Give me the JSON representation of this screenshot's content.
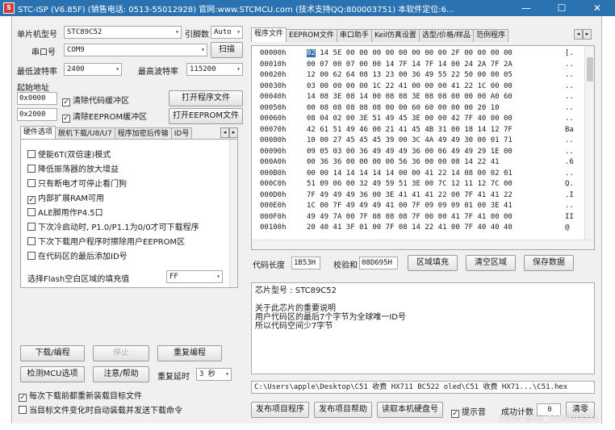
{
  "titlebar": {
    "title": "STC-ISP (V6.85F) (销售电话: 0513-55012928) 官网:www.STCMCU.com (技术支持QQ:800003751) 本软件定位:6...",
    "minimize": "—",
    "maximize": "☐",
    "close": "✕"
  },
  "left": {
    "mcu_label": "单片机型号",
    "mcu_value": "STC89C52",
    "pins_label": "引脚数",
    "pins_value": "Auto",
    "port_label": "串口号",
    "port_value": "COM9",
    "scan_button": "扫描",
    "min_baud_label": "最低波特率",
    "min_baud_value": "2400",
    "max_baud_label": "最高波特率",
    "max_baud_value": "115200",
    "start_addr_label": "起始地址",
    "addr1": "0x0000",
    "clear_code": "清除代码缓冲区",
    "open_program": "打开程序文件",
    "addr2": "0x2000",
    "clear_eeprom": "清除EEPROM缓冲区",
    "open_eeprom": "打开EEPROM文件"
  },
  "left_tabs": [
    "硬件选项",
    "脱机下载/U8/U7",
    "程序加密后传输",
    "ID号"
  ],
  "options": [
    {
      "label": "使能6T(双倍速)模式",
      "checked": false
    },
    {
      "label": "降低振荡器的放大增益",
      "checked": false
    },
    {
      "label": "只有断电才可停止看门狗",
      "checked": false
    },
    {
      "label": "内部扩展RAM可用",
      "checked": true
    },
    {
      "label": "ALE脚用作P4.5口",
      "checked": false
    },
    {
      "label": "下次冷启动时, P1.0/P1.1为0/0才可下载程序",
      "checked": false
    },
    {
      "label": "下次下载用户程序时擦除用户EEPROM区",
      "checked": false
    },
    {
      "label": "在代码区的最后添加ID号",
      "checked": false
    }
  ],
  "fill": {
    "label": "选择Flash空白区域的填充值",
    "value": "FF"
  },
  "actions": {
    "download": "下载/编程",
    "stop": "停止",
    "reprogram": "重复编程",
    "check_mcu": "检测MCU选项",
    "help": "注意/帮助",
    "delay_label": "重复延时",
    "delay_value": "3 秒",
    "reload_each": "每次下载前都重新装载目标文件",
    "auto_reload": "当目标文件变化时自动装载并发送下载命令"
  },
  "right_tabs": [
    "程序文件",
    "EEPROM文件",
    "串口助手",
    "Keil仿真设置",
    "选型/价格/样品",
    "范例程序"
  ],
  "hex": {
    "rows": [
      {
        "addr": "00000h",
        "bytes": [
          "02",
          "14",
          "5E",
          "00",
          "00",
          "00",
          "00",
          "00",
          "00",
          "00",
          "00",
          "2F",
          "00",
          "00",
          "00",
          "00"
        ],
        "ascii": "[."
      },
      {
        "addr": "00010h",
        "bytes": [
          "00",
          "07",
          "00",
          "07",
          "00",
          "00",
          "14",
          "7F",
          "14",
          "7F",
          "14",
          "00",
          "24",
          "2A",
          "7F",
          "2A"
        ],
        "ascii": ".."
      },
      {
        "addr": "00020h",
        "bytes": [
          "12",
          "00",
          "62",
          "64",
          "08",
          "13",
          "23",
          "00",
          "36",
          "49",
          "55",
          "22",
          "50",
          "00",
          "00",
          "05"
        ],
        "ascii": ".."
      },
      {
        "addr": "00030h",
        "bytes": [
          "03",
          "00",
          "00",
          "00",
          "00",
          "1C",
          "22",
          "41",
          "00",
          "00",
          "00",
          "41",
          "22",
          "1C",
          "00",
          "00"
        ],
        "ascii": ".."
      },
      {
        "addr": "00040h",
        "bytes": [
          "14",
          "08",
          "3E",
          "08",
          "14",
          "00",
          "08",
          "08",
          "3E",
          "08",
          "08",
          "00",
          "00",
          "00",
          "A0",
          "60"
        ],
        "ascii": ".."
      },
      {
        "addr": "00050h",
        "bytes": [
          "00",
          "08",
          "08",
          "08",
          "08",
          "08",
          "00",
          "00",
          "60",
          "60",
          "00",
          "00",
          "00",
          "20",
          "10"
        ],
        "ascii": ".."
      },
      {
        "addr": "00060h",
        "bytes": [
          "08",
          "04",
          "02",
          "00",
          "3E",
          "51",
          "49",
          "45",
          "3E",
          "00",
          "00",
          "42",
          "7F",
          "40",
          "00",
          "00"
        ],
        "ascii": ".."
      },
      {
        "addr": "00070h",
        "bytes": [
          "42",
          "61",
          "51",
          "49",
          "46",
          "00",
          "21",
          "41",
          "45",
          "4B",
          "31",
          "00",
          "18",
          "14",
          "12",
          "7F"
        ],
        "ascii": "Ba"
      },
      {
        "addr": "00080h",
        "bytes": [
          "10",
          "00",
          "27",
          "45",
          "45",
          "45",
          "39",
          "00",
          "3C",
          "4A",
          "49",
          "49",
          "30",
          "00",
          "01",
          "71"
        ],
        "ascii": ".."
      },
      {
        "addr": "00090h",
        "bytes": [
          "09",
          "05",
          "03",
          "00",
          "36",
          "49",
          "49",
          "49",
          "36",
          "00",
          "06",
          "49",
          "49",
          "29",
          "1E",
          "00"
        ],
        "ascii": ".."
      },
      {
        "addr": "000A0h",
        "bytes": [
          "00",
          "36",
          "36",
          "00",
          "00",
          "00",
          "00",
          "56",
          "36",
          "00",
          "00",
          "08",
          "14",
          "22",
          "41"
        ],
        "ascii": ".6"
      },
      {
        "addr": "000B0h",
        "bytes": [
          "00",
          "00",
          "14",
          "14",
          "14",
          "14",
          "14",
          "00",
          "00",
          "41",
          "22",
          "14",
          "08",
          "00",
          "02",
          "01"
        ],
        "ascii": ".."
      },
      {
        "addr": "000C0h",
        "bytes": [
          "51",
          "09",
          "06",
          "00",
          "32",
          "49",
          "59",
          "51",
          "3E",
          "00",
          "7C",
          "12",
          "11",
          "12",
          "7C",
          "00"
        ],
        "ascii": "Q."
      },
      {
        "addr": "000D0h",
        "bytes": [
          "7F",
          "49",
          "49",
          "49",
          "36",
          "00",
          "3E",
          "41",
          "41",
          "41",
          "22",
          "00",
          "7F",
          "41",
          "41",
          "22"
        ],
        "ascii": ".I"
      },
      {
        "addr": "000E0h",
        "bytes": [
          "1C",
          "00",
          "7F",
          "49",
          "49",
          "49",
          "41",
          "00",
          "7F",
          "09",
          "09",
          "09",
          "01",
          "00",
          "3E",
          "41"
        ],
        "ascii": ".."
      },
      {
        "addr": "000F0h",
        "bytes": [
          "49",
          "49",
          "7A",
          "00",
          "7F",
          "08",
          "08",
          "08",
          "7F",
          "00",
          "00",
          "41",
          "7F",
          "41",
          "00",
          "00"
        ],
        "ascii": "II"
      },
      {
        "addr": "00100h",
        "bytes": [
          "20",
          "40",
          "41",
          "3F",
          "01",
          "00",
          "7F",
          "08",
          "14",
          "22",
          "41",
          "00",
          "7F",
          "40",
          "40",
          "40"
        ],
        "ascii": "@"
      }
    ]
  },
  "hexbar": {
    "length_label": "代码长度",
    "length_value": "1B53H",
    "checksum_label": "校验和",
    "checksum_value": "08D695H",
    "fill_area": "区域填充",
    "clear_area": "清空区域",
    "save": "保存数据"
  },
  "info": {
    "lines": [
      "芯片型号 : STC89C52",
      "",
      "关于此芯片的重要说明",
      "    用户代码区的最后7个字节为全球唯一ID号",
      "    所以代码空间少7字节"
    ]
  },
  "path": "C:\\Users\\apple\\Desktop\\C51 收费 HX711 BC522 oled\\C51 收费 HX71...\\C51.hex",
  "bottom": {
    "publish": "发布项目程序",
    "publish_help": "发布项目帮助",
    "read_serial": "读取本机硬盘号",
    "notify": "提示音",
    "success_label": "成功计数",
    "success_value": "0",
    "clear": "清零"
  },
  "watermark": "CSDN @qq_1039692211"
}
